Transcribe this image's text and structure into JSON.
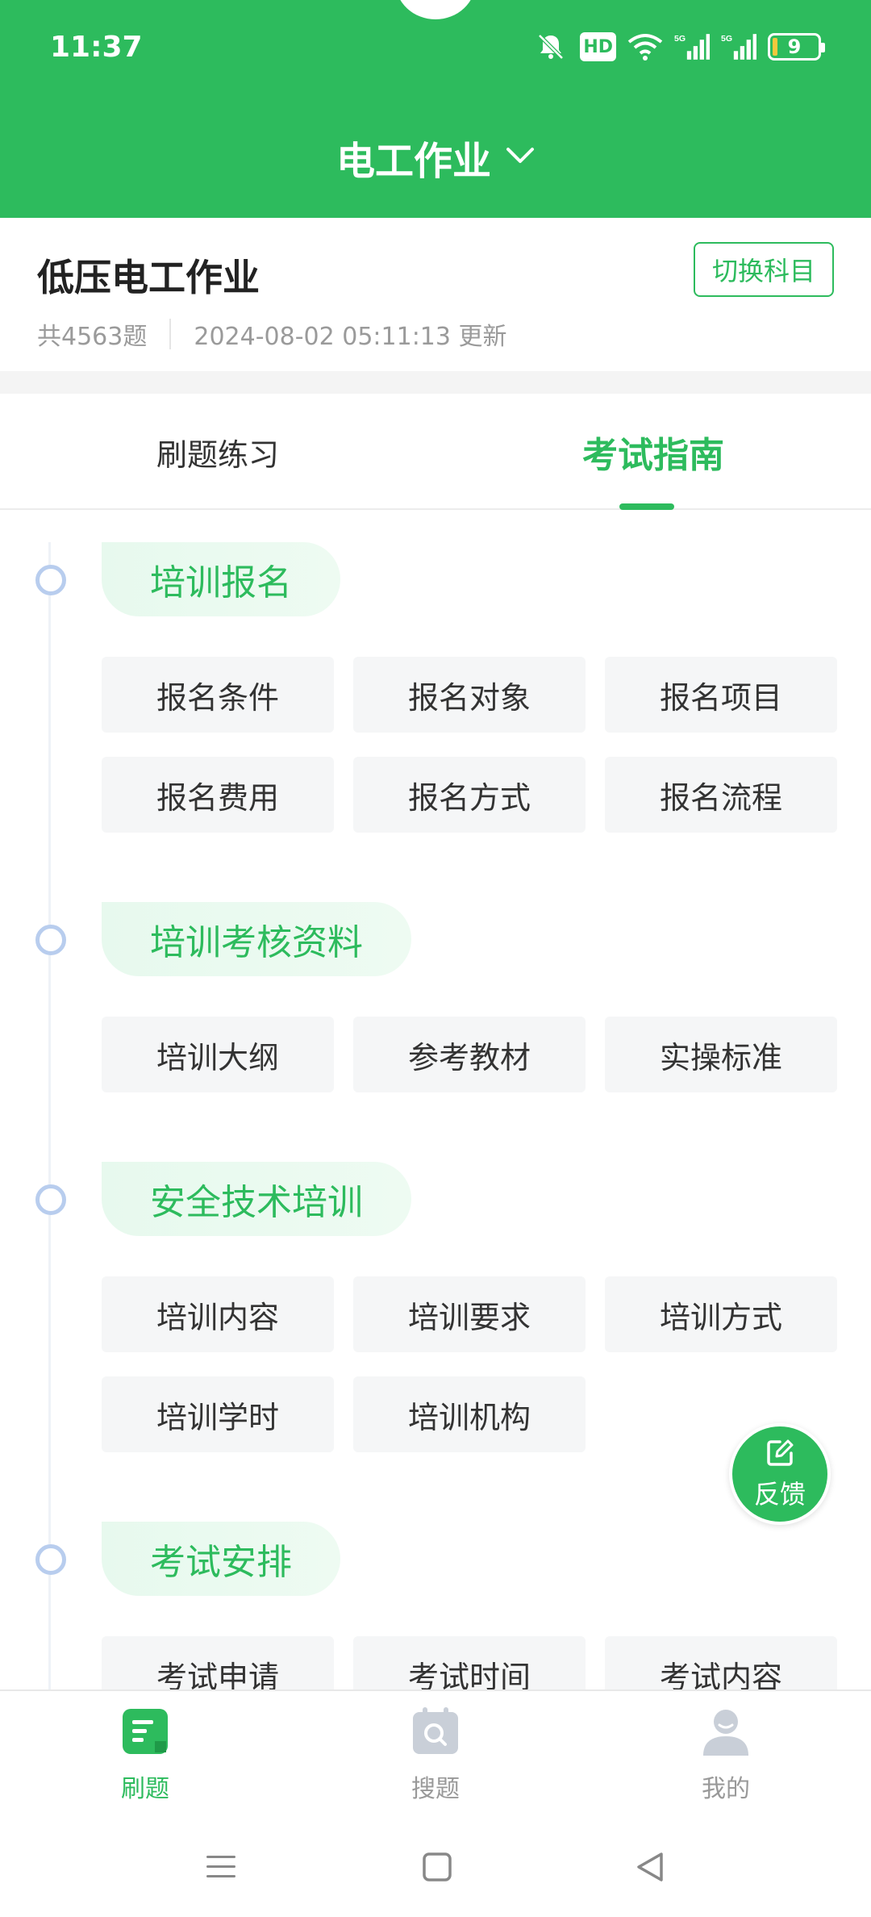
{
  "status_bar": {
    "time": "11:37",
    "hd_label": "HD",
    "signal_label_1": "5G",
    "signal_label_2": "5G",
    "battery": "9"
  },
  "header": {
    "title": "电工作业"
  },
  "subject": {
    "name": "低压电工作业",
    "count": "共4563题",
    "updated": "2024-08-02 05:11:13 更新",
    "switch_label": "切换科目"
  },
  "tabs": [
    {
      "label": "刷题练习",
      "active": false
    },
    {
      "label": "考试指南",
      "active": true
    }
  ],
  "sections": [
    {
      "title": "培训报名",
      "items": [
        "报名条件",
        "报名对象",
        "报名项目",
        "报名费用",
        "报名方式",
        "报名流程"
      ]
    },
    {
      "title": "培训考核资料",
      "items": [
        "培训大纲",
        "参考教材",
        "实操标准"
      ]
    },
    {
      "title": "安全技术培训",
      "items": [
        "培训内容",
        "培训要求",
        "培训方式",
        "培训学时",
        "培训机构"
      ]
    },
    {
      "title": "考试安排",
      "items": [
        "考试申请",
        "考试时间",
        "考试内容"
      ]
    }
  ],
  "fab": {
    "label": "反馈"
  },
  "bottom_nav": [
    {
      "label": "刷题",
      "icon": "document-icon",
      "active": true
    },
    {
      "label": "搜题",
      "icon": "search-calendar-icon",
      "active": false
    },
    {
      "label": "我的",
      "icon": "user-icon",
      "active": false
    }
  ],
  "colors": {
    "brand": "#2dbb5d",
    "dot_border": "#b8cdee",
    "cell_bg": "#f5f6f7"
  }
}
